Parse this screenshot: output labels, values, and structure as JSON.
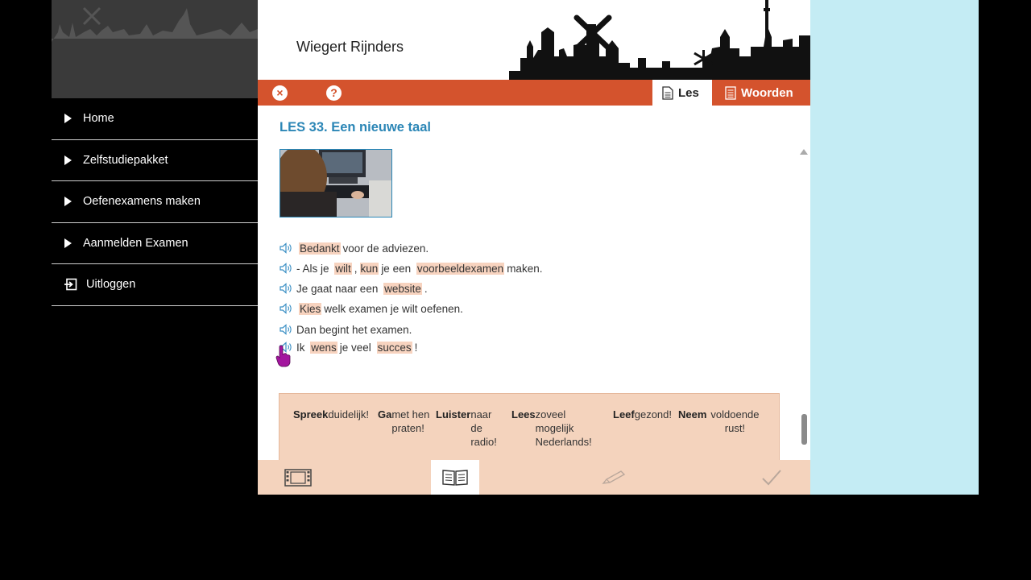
{
  "sidebar": {
    "items": [
      {
        "label": "Home"
      },
      {
        "label": "Zelfstudiepakket"
      },
      {
        "label": "Oefenexamens maken"
      },
      {
        "label": "Aanmelden Examen"
      },
      {
        "label": "Uitloggen",
        "icon": "logout-icon"
      }
    ]
  },
  "header": {
    "user_name": "Wiegert Rijnders"
  },
  "toolbar": {
    "close_icon": "×",
    "help_icon": "?",
    "tabs": [
      {
        "label": "Les",
        "active": true
      },
      {
        "label": "Woorden",
        "active": false
      }
    ]
  },
  "lesson": {
    "title": "LES 33. Een nieuwe taal",
    "sentences": [
      [
        {
          "t": "Bedankt",
          "h": true
        },
        {
          "t": "voor de adviezen."
        }
      ],
      [
        {
          "t": "- Als je "
        },
        {
          "t": "wilt",
          "h": true
        },
        {
          "t": ","
        },
        {
          "t": "kun",
          "h": true
        },
        {
          "t": "je een "
        },
        {
          "t": "voorbeeldexamen",
          "h": true
        },
        {
          "t": "maken."
        }
      ],
      [
        {
          "t": "Je gaat naar een "
        },
        {
          "t": "website",
          "h": true
        },
        {
          "t": "."
        }
      ],
      [
        {
          "t": "Kies",
          "h": true
        },
        {
          "t": "welk examen je wilt oefenen."
        }
      ],
      [
        {
          "t": "Dan begint het examen."
        }
      ],
      [
        {
          "t": "Ik "
        },
        {
          "t": "wens",
          "h": true
        },
        {
          "t": "je veel "
        },
        {
          "t": "succes",
          "h": true
        },
        {
          "t": "!"
        }
      ]
    ],
    "tips": [
      {
        "bold": "Spreek",
        "rest": "duidelijk!"
      },
      {
        "bold": "Ga",
        "rest": "met hen praten!"
      },
      {
        "bold": "Luister",
        "rest": "naar de radio!"
      },
      {
        "bold": "Lees",
        "rest": "zoveel mogelijk Nederlands!"
      },
      {
        "bold": "Leef",
        "rest": "gezond!"
      },
      {
        "bold": "Neem",
        "rest": "voldoende rust!"
      }
    ]
  },
  "colors": {
    "accent": "#d4532d",
    "title_blue": "#2b86b6",
    "highlight": "#f7d3bf",
    "right_panel": "#c4ecf4"
  },
  "bottombar": {
    "icons": [
      "film-icon",
      "open-book-icon",
      "pencil-icon",
      "checkmark-icon"
    ]
  }
}
